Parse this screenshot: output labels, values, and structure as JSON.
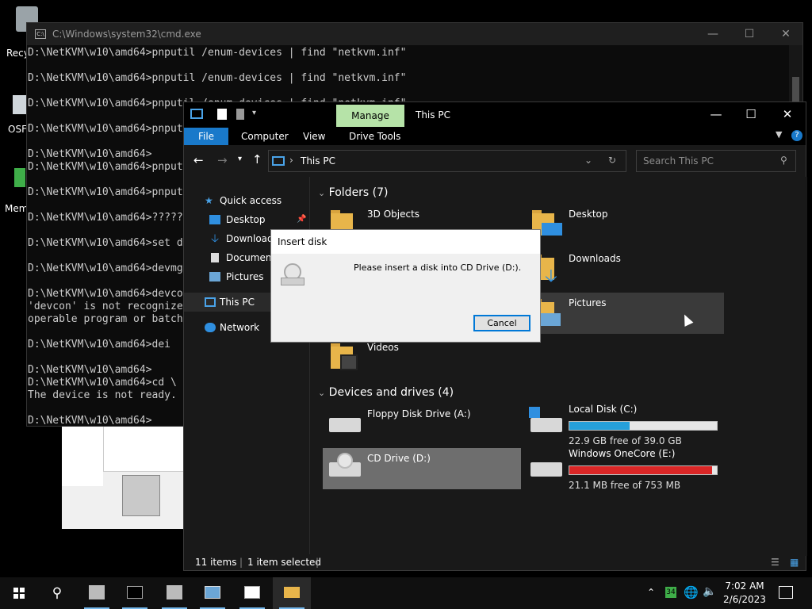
{
  "desktop": {
    "icons": [
      {
        "label": "Recy"
      },
      {
        "label": "OSF"
      },
      {
        "label": "Mem"
      }
    ]
  },
  "cmd": {
    "title": "C:\\Windows\\system32\\cmd.exe",
    "lines": [
      "D:\\NetKVM\\w10\\amd64>pnputil /enum-devices | find \"netkvm.inf\"",
      "",
      "D:\\NetKVM\\w10\\amd64>pnputil /enum-devices | find \"netkvm.inf\"",
      "",
      "D:\\NetKVM\\w10\\amd64>pnputil /enum-devices | find \"netkvm.inf\"",
      "",
      "D:\\NetKVM\\w10\\amd64>pnput",
      "",
      "D:\\NetKVM\\w10\\amd64>",
      "D:\\NetKVM\\w10\\amd64>pnput",
      "",
      "D:\\NetKVM\\w10\\amd64>pnput",
      "",
      "D:\\NetKVM\\w10\\amd64>?????",
      "",
      "D:\\NetKVM\\w10\\amd64>set d",
      "",
      "D:\\NetKVM\\w10\\amd64>devmg",
      "",
      "D:\\NetKVM\\w10\\amd64>devco",
      "'devcon' is not recognize",
      "operable program or batch",
      "",
      "D:\\NetKVM\\w10\\amd64>dei",
      "",
      "D:\\NetKVM\\w10\\amd64>",
      "D:\\NetKVM\\w10\\amd64>cd \\",
      "The device is not ready.",
      "",
      "D:\\NetKVM\\w10\\amd64>"
    ]
  },
  "explorer": {
    "ribbon_context_tab": "Manage",
    "title": "This PC",
    "tabs": {
      "file": "File",
      "computer": "Computer",
      "view": "View",
      "drive_tools": "Drive Tools"
    },
    "address": "This PC",
    "search_placeholder": "Search This PC",
    "nav": {
      "quick_access": "Quick access",
      "desktop": "Desktop",
      "downloads": "Downloads",
      "documents": "Document",
      "pictures": "Pictures",
      "this_pc": "This PC",
      "network": "Network"
    },
    "folders_header": "Folders (7)",
    "folders": {
      "objects3d": "3D Objects",
      "desktop": "Desktop",
      "downloads": "Downloads",
      "pictures": "Pictures",
      "videos": "Videos"
    },
    "devices_header": "Devices and drives (4)",
    "drives": {
      "floppy": {
        "name": "Floppy Disk Drive (A:)"
      },
      "cd": {
        "name": "CD Drive (D:)"
      },
      "local": {
        "name": "Local Disk (C:)",
        "free": "22.9 GB free of 39.0 GB",
        "used_fraction": 0.41,
        "bar_color": "#26a0da"
      },
      "onecore": {
        "name": "Windows OneCore (E:)",
        "free": "21.1 MB free of 753 MB",
        "used_fraction": 0.97,
        "bar_color": "#da2626"
      }
    },
    "status": {
      "items": "11 items",
      "selected": "1 item selected"
    }
  },
  "dialog": {
    "title": "Insert disk",
    "message": "Please insert a disk into CD Drive (D:).",
    "cancel": "Cancel"
  },
  "taskbar": {
    "badge": "34",
    "time": "7:02 AM",
    "date": "2/6/2023"
  }
}
